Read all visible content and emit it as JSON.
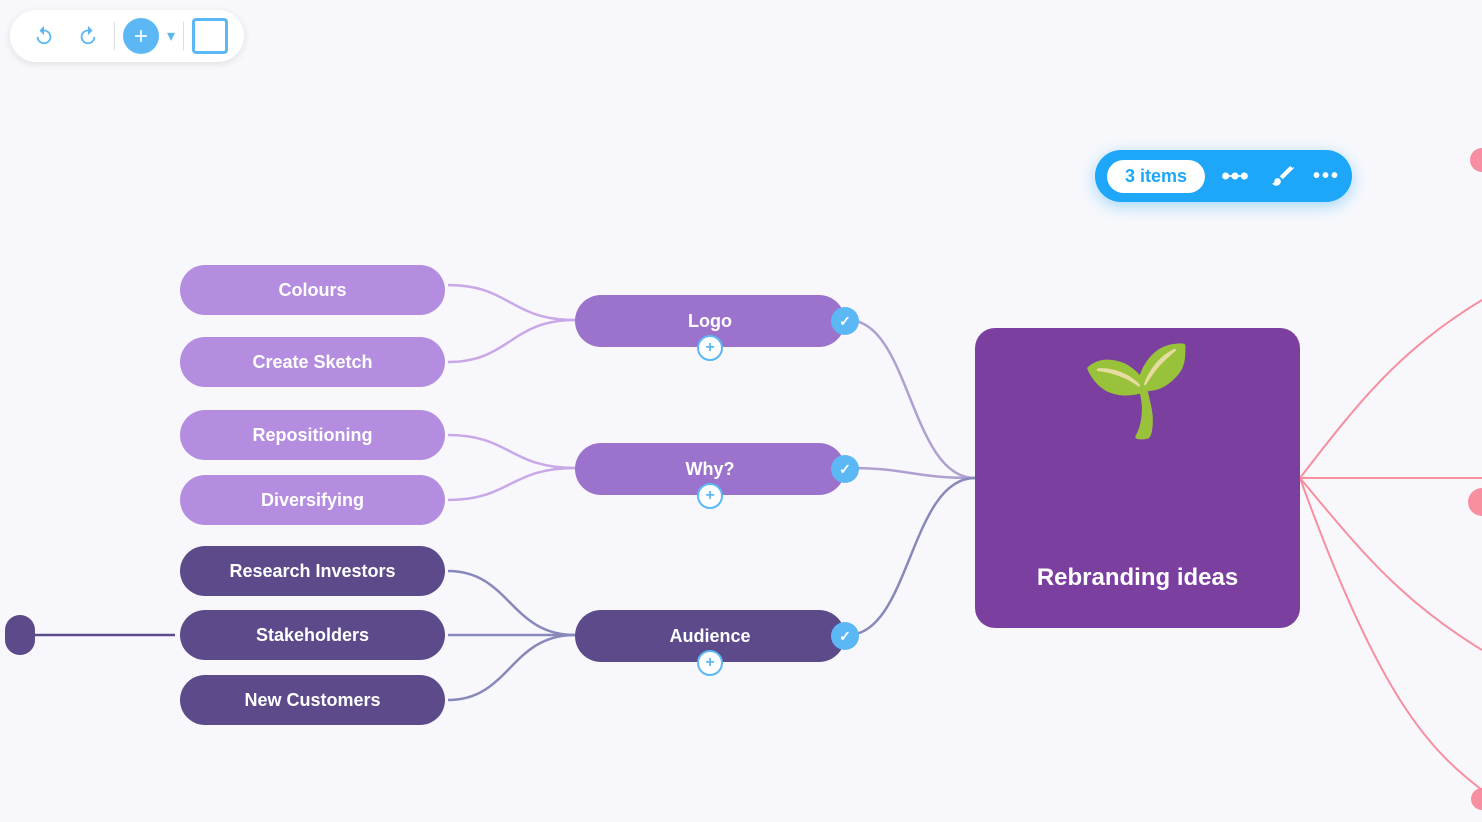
{
  "toolbar": {
    "undo_label": "←",
    "redo_label": "→",
    "add_label": "+",
    "chevron_label": "▾",
    "frame_label": ""
  },
  "badge": {
    "items_label": "3 items",
    "more_label": "•••"
  },
  "nodes": {
    "colours": "Colours",
    "create_sketch": "Create Sketch",
    "repositioning": "Repositioning",
    "diversifying": "Diversifying",
    "logo": "Logo",
    "why": "Why?",
    "research_investors": "Research Investors",
    "stakeholders": "Stakeholders",
    "new_customers": "New Customers",
    "audience": "Audience",
    "central": "Rebranding ideas"
  },
  "colors": {
    "light_purple": "#b48de0",
    "mid_purple": "#9b72cc",
    "dark_purple": "#5d4a8a",
    "central": "#7b3fa0",
    "blue_accent": "#1ea7f8",
    "pink_deco": "#f78fa0"
  }
}
